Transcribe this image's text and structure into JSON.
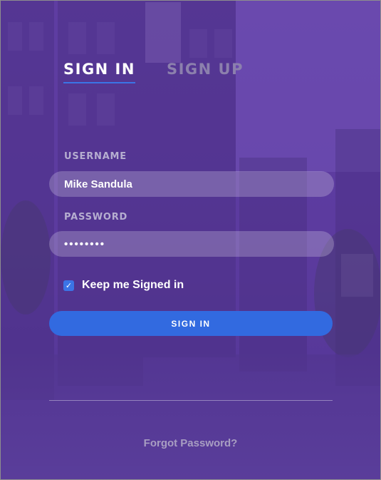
{
  "tabs": {
    "sign_in": "SIGN IN",
    "sign_up": "SIGN UP"
  },
  "form": {
    "username_label": "USERNAME",
    "username_value": "Mike Sandula",
    "password_label": "PASSWORD",
    "password_value": "••••••••",
    "keep_signed_in_label": "Keep me Signed in",
    "keep_signed_in_checked": true,
    "submit_label": "SIGN IN"
  },
  "footer": {
    "forgot_password": "Forgot Password?"
  },
  "colors": {
    "accent": "#326ae0",
    "overlay": "#6a3cb0"
  },
  "icons": {
    "checkbox": "check-icon"
  }
}
